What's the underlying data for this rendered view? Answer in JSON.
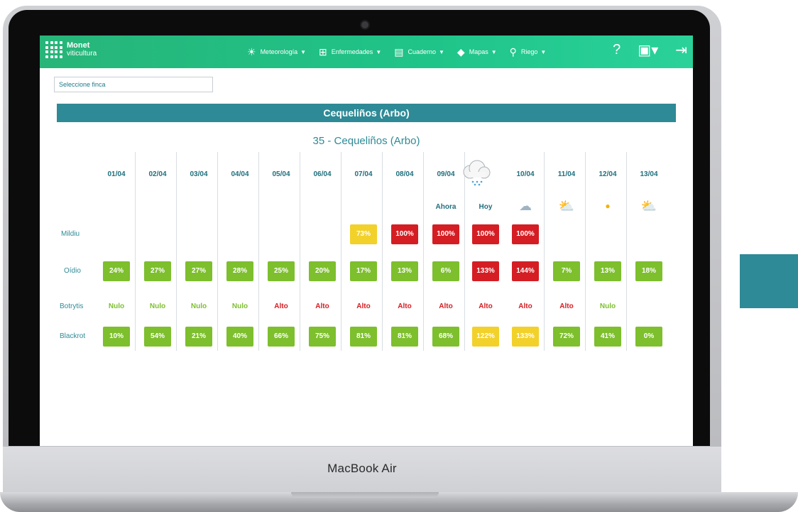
{
  "device": {
    "brand": "MacBook Air"
  },
  "navbar": {
    "logo_line1": "Monet",
    "logo_line2": "viticultura",
    "items": [
      {
        "label": "Meteorología",
        "icon": "sun-icon"
      },
      {
        "label": "Enfermedades",
        "icon": "plus-box-icon"
      },
      {
        "label": "Cuaderno",
        "icon": "notebook-icon"
      },
      {
        "label": "Mapas",
        "icon": "layers-icon"
      },
      {
        "label": "Riego",
        "icon": "tap-icon"
      }
    ],
    "right": {
      "help_icon": "help-icon",
      "user_icon": "user-icon",
      "logout_icon": "logout-icon"
    }
  },
  "finca_select": {
    "placeholder": "Seleccione finca"
  },
  "page_title": "Cequeliños (Arbo)",
  "table_title": "35 - Cequeliños (Arbo)",
  "colors": {
    "green": "#7dbf2d",
    "red": "#d41e24",
    "yellow": "#f2d12a",
    "teal": "#2e8a96"
  },
  "table": {
    "dates": [
      "01/04",
      "02/04",
      "03/04",
      "04/04",
      "05/04",
      "06/04",
      "07/04",
      "08/04",
      "09/04",
      "",
      "10/04",
      "11/04",
      "12/04",
      "13/04"
    ],
    "sub_labels": {
      "now": "Ahora",
      "today": "Hoy"
    },
    "weather_icons": [
      "",
      "",
      "",
      "",
      "",
      "",
      "",
      "",
      "",
      "rain-cloud-icon",
      "snow-cloud-icon",
      "partly-cloudy-icon",
      "sun-icon",
      "partly-cloudy-icon"
    ],
    "rows": [
      {
        "label": "Mildiu",
        "cells": [
          null,
          null,
          null,
          null,
          null,
          null,
          {
            "v": "73%",
            "c": "yellow"
          },
          {
            "v": "100%",
            "c": "red"
          },
          {
            "v": "100%",
            "c": "red"
          },
          {
            "v": "100%",
            "c": "red"
          },
          {
            "v": "100%",
            "c": "red"
          },
          null,
          null,
          null
        ]
      },
      {
        "label": "Oídio",
        "cells": [
          {
            "v": "24%",
            "c": "green"
          },
          {
            "v": "27%",
            "c": "green"
          },
          {
            "v": "27%",
            "c": "green"
          },
          {
            "v": "28%",
            "c": "green"
          },
          {
            "v": "25%",
            "c": "green"
          },
          {
            "v": "20%",
            "c": "green"
          },
          {
            "v": "17%",
            "c": "green"
          },
          {
            "v": "13%",
            "c": "green"
          },
          {
            "v": "6%",
            "c": "green"
          },
          {
            "v": "133%",
            "c": "red"
          },
          {
            "v": "144%",
            "c": "red"
          },
          {
            "v": "7%",
            "c": "green"
          },
          {
            "v": "13%",
            "c": "green"
          },
          {
            "v": "18%",
            "c": "green"
          }
        ]
      },
      {
        "label": "Botrytis",
        "cells": [
          {
            "t": "Nulo",
            "c": "green"
          },
          {
            "t": "Nulo",
            "c": "green"
          },
          {
            "t": "Nulo",
            "c": "green"
          },
          {
            "t": "Nulo",
            "c": "green"
          },
          {
            "t": "Alto",
            "c": "red"
          },
          {
            "t": "Alto",
            "c": "red"
          },
          {
            "t": "Alto",
            "c": "red"
          },
          {
            "t": "Alto",
            "c": "red"
          },
          {
            "t": "Alto",
            "c": "red"
          },
          {
            "t": "Alto",
            "c": "red"
          },
          {
            "t": "Alto",
            "c": "red"
          },
          {
            "t": "Alto",
            "c": "red"
          },
          {
            "t": "Nulo",
            "c": "green"
          },
          null
        ]
      },
      {
        "label": "Blackrot",
        "cells": [
          {
            "v": "10%",
            "c": "green"
          },
          {
            "v": "54%",
            "c": "green"
          },
          {
            "v": "21%",
            "c": "green"
          },
          {
            "v": "40%",
            "c": "green"
          },
          {
            "v": "66%",
            "c": "green"
          },
          {
            "v": "75%",
            "c": "green"
          },
          {
            "v": "81%",
            "c": "green"
          },
          {
            "v": "81%",
            "c": "green"
          },
          {
            "v": "68%",
            "c": "green"
          },
          {
            "v": "122%",
            "c": "yellow"
          },
          {
            "v": "133%",
            "c": "yellow"
          },
          {
            "v": "72%",
            "c": "green"
          },
          {
            "v": "41%",
            "c": "green"
          },
          {
            "v": "0%",
            "c": "green"
          }
        ]
      }
    ]
  }
}
